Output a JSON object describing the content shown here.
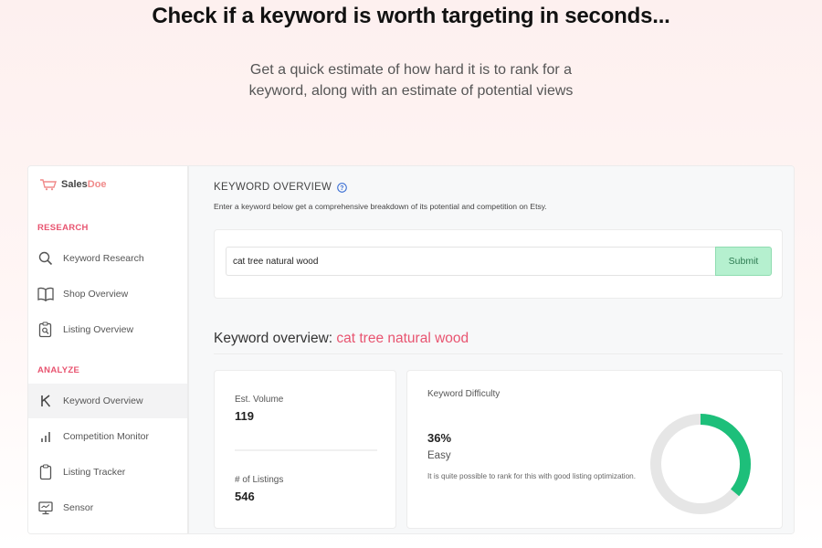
{
  "hero": {
    "title": "Check if a keyword is worth targeting in seconds...",
    "subtitle": "Get a quick estimate of how hard it is to rank for a keyword, along with an estimate of potential views"
  },
  "brand": {
    "part1": "Sales",
    "part2": "Doe"
  },
  "sidebar": {
    "sections": [
      {
        "label": "RESEARCH",
        "items": [
          {
            "label": "Keyword Research",
            "icon": "search-icon"
          },
          {
            "label": "Shop Overview",
            "icon": "book-icon"
          },
          {
            "label": "Listing Overview",
            "icon": "clipboard-search-icon"
          }
        ]
      },
      {
        "label": "ANALYZE",
        "items": [
          {
            "label": "Keyword Overview",
            "icon": "k-icon",
            "active": true
          },
          {
            "label": "Competition Monitor",
            "icon": "bar-chart-icon"
          },
          {
            "label": "Listing Tracker",
            "icon": "clipboard-icon"
          },
          {
            "label": "Sensor",
            "icon": "monitor-icon"
          }
        ]
      }
    ]
  },
  "main": {
    "title": "KEYWORD OVERVIEW",
    "description": "Enter a keyword below get a comprehensive breakdown of its potential and competition on Etsy.",
    "search": {
      "value": "cat tree natural wood",
      "placeholder": "",
      "submit_label": "Submit"
    },
    "overview_heading": {
      "prefix": "Keyword overview: ",
      "keyword": "cat tree natural wood"
    },
    "stats": {
      "volume_label": "Est. Volume",
      "volume_value": "119",
      "listings_label": "# of Listings",
      "listings_value": "546"
    },
    "difficulty": {
      "label": "Keyword Difficulty",
      "percent_text": "36%",
      "percent": 36,
      "rating": "Easy",
      "note": "It is quite possible to rank for this with good listing optimization."
    }
  },
  "colors": {
    "accent": "#e85470",
    "brand_light": "#f08a8a",
    "submit_bg": "#b5f0cf",
    "donut_fill": "#1dbf7a",
    "donut_track": "#e6e6e6"
  }
}
